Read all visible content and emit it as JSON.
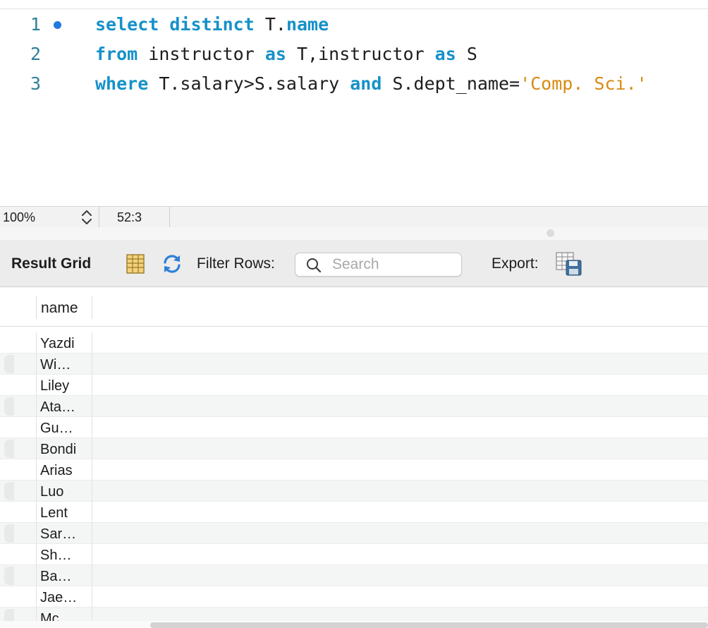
{
  "editor": {
    "lines": [
      {
        "number": "1",
        "tokens": [
          {
            "t": "select",
            "c": "kw"
          },
          {
            "t": " "
          },
          {
            "t": "distinct",
            "c": "kw"
          },
          {
            "t": " T."
          },
          {
            "t": "name",
            "c": "kw"
          }
        ]
      },
      {
        "number": "2",
        "tokens": [
          {
            "t": "from",
            "c": "kw"
          },
          {
            "t": " instructor "
          },
          {
            "t": "as",
            "c": "kw"
          },
          {
            "t": " T,instructor "
          },
          {
            "t": "as",
            "c": "kw"
          },
          {
            "t": " S"
          }
        ]
      },
      {
        "number": "3",
        "tokens": [
          {
            "t": "where",
            "c": "kw"
          },
          {
            "t": " T.salary>S.salary "
          },
          {
            "t": "and",
            "c": "kw"
          },
          {
            "t": " S.dept_name="
          },
          {
            "t": "'Comp. Sci.'",
            "c": "str"
          }
        ]
      }
    ],
    "breakpoint_line": "1"
  },
  "status_bar": {
    "zoom": "100%",
    "cursor_position": "52:3"
  },
  "toolbar": {
    "title": "Result Grid",
    "filter_label": "Filter Rows:",
    "search_placeholder": "Search",
    "search_value": "",
    "export_label": "Export:"
  },
  "grid": {
    "column": "name",
    "rows": [
      "Yazdi",
      "Wi…",
      "Liley",
      "Ata…",
      "Gu…",
      "Bondi",
      "Arias",
      "Luo",
      "Lent",
      "Sar…",
      "Sh…",
      "Ba…",
      "Jae…",
      "Mc…"
    ]
  },
  "colors": {
    "keyword": "#1591c9",
    "string": "#d98a12",
    "line_number": "#2f7f9a",
    "breakpoint": "#1f7ae0"
  },
  "icons": {
    "stepper": "up-down-chevron-icon",
    "grid": "result-grid-icon",
    "refresh": "refresh-icon",
    "search": "search-icon",
    "export": "export-icon"
  }
}
